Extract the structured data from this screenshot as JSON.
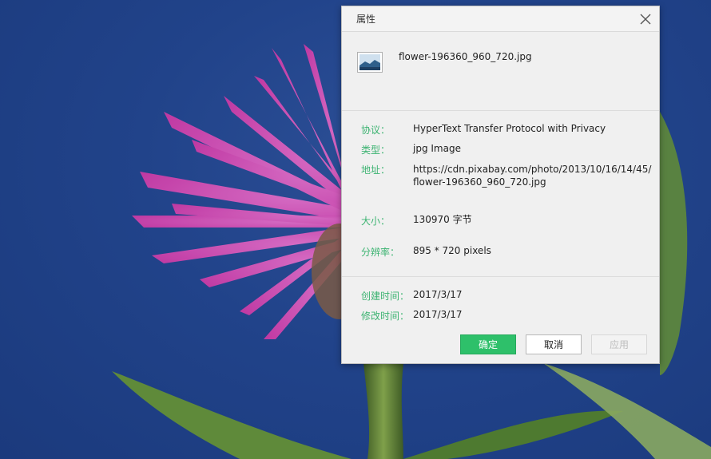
{
  "dialog": {
    "title": "属性",
    "file_name": "flower-196360_960_720.jpg",
    "fields": {
      "protocol": {
        "label": "协议：",
        "value": "HyperText Transfer Protocol with Privacy"
      },
      "type": {
        "label": "类型：",
        "value": "jpg Image"
      },
      "address": {
        "label": "地址：",
        "value_line1": "https://cdn.pixabay.com/photo/2013/10/16/14/45/",
        "value_line2": "flower-196360_960_720.jpg"
      },
      "size": {
        "label": "大小：",
        "value": "130970 字节"
      },
      "resolution": {
        "label": "分辨率：",
        "value": "895 * 720 pixels"
      },
      "created": {
        "label": "创建时间：",
        "value": "2017/3/17"
      },
      "modified": {
        "label": "修改时间：",
        "value": "2017/3/17"
      }
    },
    "buttons": {
      "ok": "确定",
      "cancel": "取消",
      "apply": "应用"
    },
    "colors": {
      "label": "#3cb371",
      "ok_button": "#2ec06a"
    }
  }
}
